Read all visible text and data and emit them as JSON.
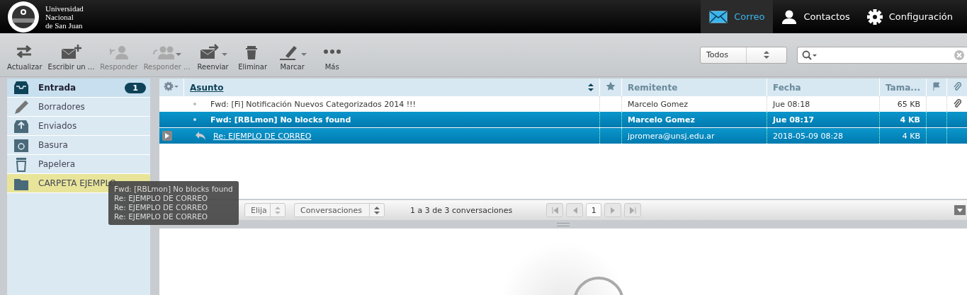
{
  "header": {
    "logo_lines": [
      "Universidad",
      "Nacional",
      "de San Juan"
    ],
    "nav": [
      {
        "label": "Correo",
        "selected": true
      },
      {
        "label": "Contactos",
        "selected": false
      },
      {
        "label": "Configuración",
        "selected": false
      }
    ]
  },
  "toolbar": {
    "buttons": [
      {
        "label": "Actualizar",
        "disabled": false,
        "dropdown": false
      },
      {
        "label": "Escribir un ...",
        "disabled": false,
        "dropdown": false
      },
      {
        "label": "Responder",
        "disabled": true,
        "dropdown": false
      },
      {
        "label": "Responder ...",
        "disabled": true,
        "dropdown": true
      },
      {
        "label": "Reenviar",
        "disabled": false,
        "dropdown": true
      },
      {
        "label": "Eliminar",
        "disabled": false,
        "dropdown": false
      },
      {
        "label": "Marcar",
        "disabled": false,
        "dropdown": true
      },
      {
        "label": "Más",
        "disabled": false,
        "dropdown": false
      }
    ],
    "filter": "Todos"
  },
  "folders": [
    {
      "label": "Entrada",
      "selected": true,
      "highlighted": false,
      "count": "1"
    },
    {
      "label": "Borradores",
      "selected": false,
      "highlighted": false
    },
    {
      "label": "Enviados",
      "selected": false,
      "highlighted": false
    },
    {
      "label": "Basura",
      "selected": false,
      "highlighted": false
    },
    {
      "label": "Papelera",
      "selected": false,
      "highlighted": false
    },
    {
      "label": "CARPETA EJEMPLO",
      "selected": false,
      "highlighted": true
    }
  ],
  "table": {
    "columns": [
      "Asunto",
      "Remitente",
      "Fecha",
      "Tama..."
    ],
    "rows": [
      {
        "subject": "Fwd: [Fi] Notificación Nuevos Categorizados 2014 !!!",
        "sender": "Marcelo Gomez",
        "date": "Jue 08:18",
        "size": "65 KB",
        "selected": false,
        "unread": false,
        "thread": false,
        "attachment": true
      },
      {
        "subject": "Fwd: [RBLmon] No blocks found",
        "sender": "Marcelo Gomez",
        "date": "Jue 08:17",
        "size": "4 KB",
        "selected": true,
        "unread": true,
        "thread": false,
        "attachment": false
      },
      {
        "subject": "Re: EJEMPLO DE CORREO",
        "sender": "jpromera@unsj.edu.ar",
        "date": "2018-05-09 08:28",
        "size": "4 KB",
        "selected": true,
        "unread": false,
        "thread": true,
        "attachment": false
      }
    ]
  },
  "pager": {
    "select_1": "Elija",
    "select_2": "Conversaciones",
    "count_text": "1 a 3 de 3 conversaciones",
    "page": "1"
  },
  "tooltip": {
    "lines": [
      "Fwd: [RBLmon] No blocks found",
      "Re: EJEMPLO DE CORREO",
      "Re: EJEMPLO DE CORREO",
      "Re: EJEMPLO DE CORREO"
    ]
  }
}
